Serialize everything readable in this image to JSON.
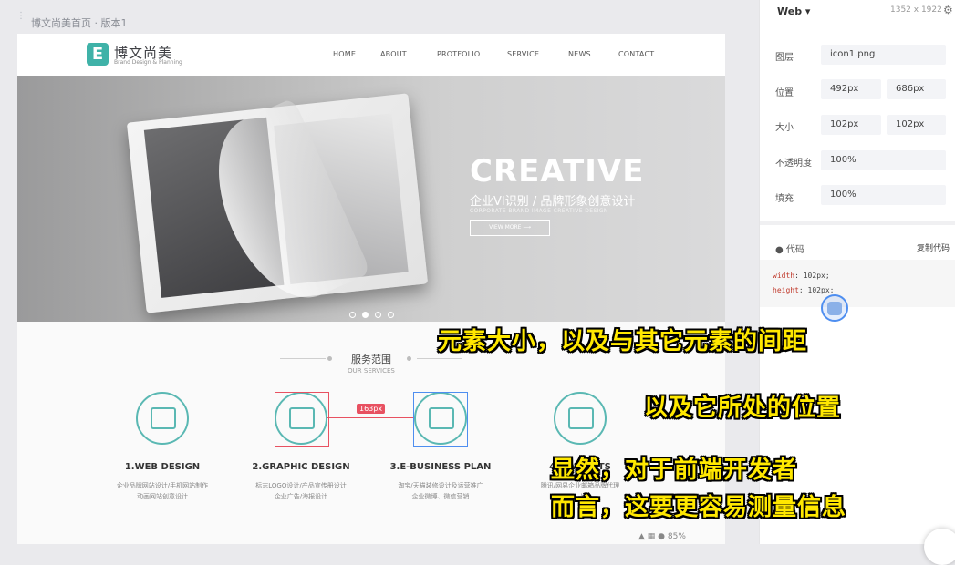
{
  "editor": {
    "document_title": "博文尚美首页 · 版本1",
    "bottom_zoom": "85%"
  },
  "site": {
    "logo_mark": "E",
    "logo_text": "博文尚美",
    "logo_sub": "Brand Design & Planning",
    "nav": [
      "HOME",
      "ABOUT",
      "PROTFOLIO",
      "SERVICE",
      "NEWS",
      "CONTACT"
    ],
    "hero": {
      "title": "CREATIVE",
      "subtitle": "企业VI识别 / 品牌形象创意设计",
      "tagline": "CORPORATE BRAND IMAGE CREATIVE DESIGN",
      "button": "VIEW MORE ⟶"
    },
    "services_title": "服务范围",
    "services_sub": "OUR SERVICES",
    "services": [
      {
        "name": "1.WEB DESIGN",
        "desc1": "企业品牌网站设计/手机网站制作",
        "desc2": "动画网站创意设计",
        "icon": "monitor-icon"
      },
      {
        "name": "2.GRAPHIC DESIGN",
        "desc1": "标志LOGO设计/产品宣传册设计",
        "desc2": "企业广告/海报设计",
        "icon": "image-icon"
      },
      {
        "name": "3.E-BUSINESS PLAN",
        "desc1": "淘宝/天猫装修设计及运营推广",
        "desc2": "企业微博、微信营销",
        "icon": "cart-icon"
      },
      {
        "name": "4.MA…ENTS",
        "desc1": "腾讯/网易企业邮箱品牌代理",
        "desc2": "…发",
        "icon": "mail-icon"
      }
    ]
  },
  "measure": {
    "distance": "163px"
  },
  "panel": {
    "platform": "Web",
    "canvas_size": "1352 x 1922",
    "rows": [
      {
        "label": "图层",
        "values": [
          "icon1.png"
        ]
      },
      {
        "label": "位置",
        "values": [
          "492px",
          "686px"
        ]
      },
      {
        "label": "大小",
        "values": [
          "102px",
          "102px"
        ]
      },
      {
        "label": "不透明度",
        "values": [
          "100%"
        ]
      },
      {
        "label": "填充",
        "values": [
          "100%"
        ]
      }
    ],
    "code_title": "代码",
    "copy_label": "复制代码",
    "code_lines": [
      {
        "prop": "width",
        "value": " 102px;"
      },
      {
        "prop": "height",
        "value": " 102px;"
      }
    ]
  },
  "captions": [
    "元素大小，以及与其它元素的间距",
    "以及它所处的位置",
    "显然，对于前端开发者",
    "而言，这要更容易测量信息"
  ],
  "colors": {
    "accent": "#3fb2a8",
    "measure": "#e85161",
    "caption": "#ffe800"
  }
}
